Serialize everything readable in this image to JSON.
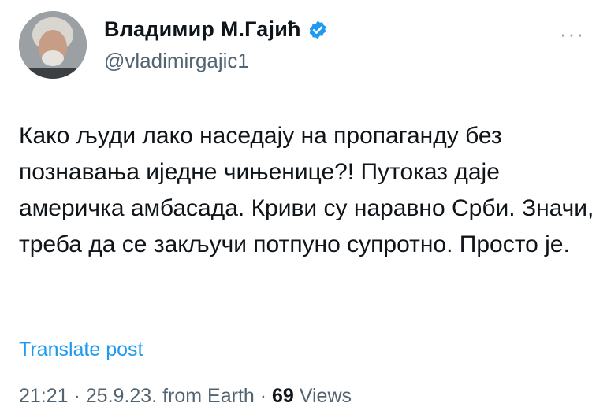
{
  "author": {
    "display_name": "Владимир М.Гајић",
    "handle": "@vladimirgajic1",
    "verified": true
  },
  "icons": {
    "verified_badge": "verified-badge-icon",
    "more": "more-options-icon"
  },
  "more_label": "···",
  "tweet": {
    "text": "Како људи лако наседају на пропаганду без познавања иједне чињенице?! Путоказ даје америчка амбасада. Криви су наравно Срби. Значи, треба да се закључи потпуно супротно. Просто је."
  },
  "translate_label": "Translate post",
  "meta": {
    "time": "21:21",
    "separator": " · ",
    "date": "25.9.23.",
    "source": "from Earth",
    "views_count": "69",
    "views_label": " Views"
  },
  "colors": {
    "link": "#1d9bf0",
    "secondary_text": "#536471",
    "verified": "#1d9bf0"
  }
}
